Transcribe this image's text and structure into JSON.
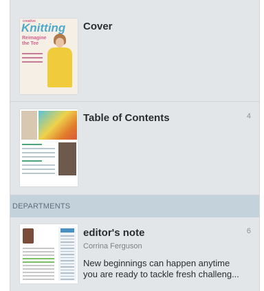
{
  "sections": [
    {
      "header": "",
      "items": [
        {
          "title": "Cover",
          "page": ""
        },
        {
          "title": "Table of Contents",
          "page": "4"
        }
      ]
    },
    {
      "header": "DEPARTMENTS",
      "items": [
        {
          "title": "editor's note",
          "page": "6",
          "author": "Corrina Ferguson",
          "excerpt_line1": "New beginnings can happen anytime",
          "excerpt_line2": "you are ready to tackle fresh challeng..."
        }
      ]
    }
  ],
  "cover_thumb": {
    "masthead": "Knitting",
    "tagline": "creative",
    "headline": "Reimagine the Tee"
  },
  "colors": {
    "panel_bg": "#e3e6e9",
    "section_header_bg": "#c3d2db",
    "section_header_text": "#5f6f7c",
    "title_text": "#2a2d30",
    "meta_text": "#8e9296"
  }
}
